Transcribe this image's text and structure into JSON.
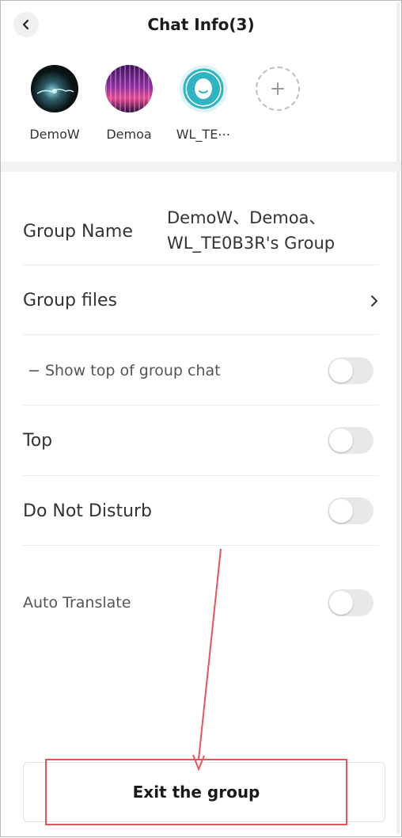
{
  "header": {
    "title": "Chat Info(3)"
  },
  "members": [
    {
      "name": "DemoW"
    },
    {
      "name": "Demoa"
    },
    {
      "name": "WL_TE⋯"
    }
  ],
  "settings": {
    "group_name_label": "Group Name",
    "group_name_line1": "DemoW、Demoa、",
    "group_name_line2": "WL_TE0B3R's Group",
    "group_files_label": "Group files",
    "show_top_label": "− Show top of group chat",
    "top_label": "Top",
    "dnd_label": "Do Not Disturb",
    "auto_translate_label": "Auto Translate"
  },
  "toggles": {
    "show_top": false,
    "top": false,
    "dnd": false,
    "auto_translate": false
  },
  "footer": {
    "exit_label": "Exit the group"
  },
  "colors": {
    "annotation": "#e8545c",
    "teal_avatar": "#2fb4c4"
  }
}
